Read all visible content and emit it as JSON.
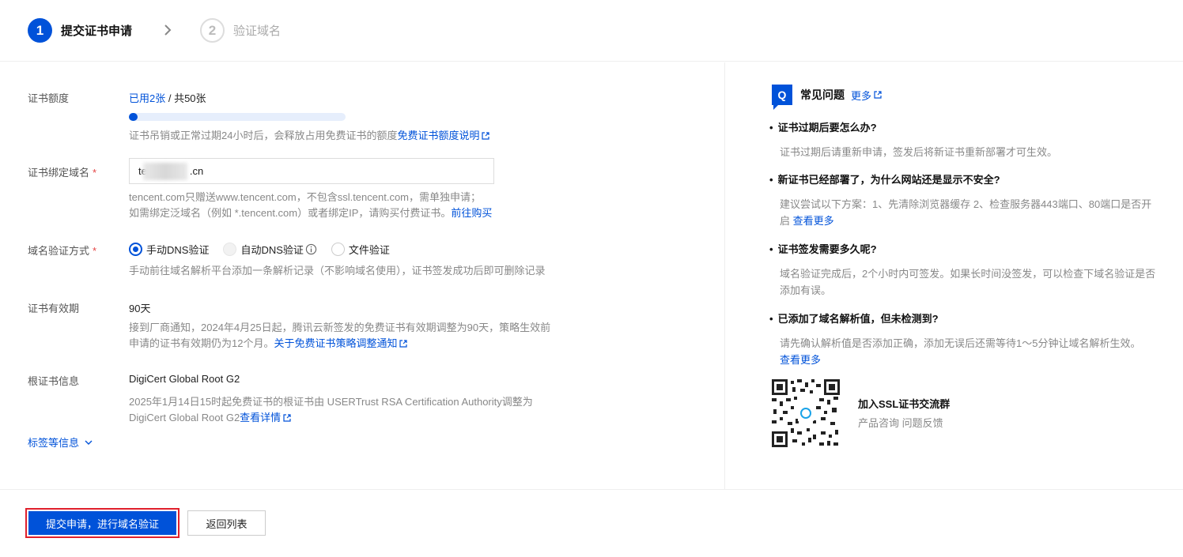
{
  "steps": [
    {
      "num": "1",
      "label": "提交证书申请"
    },
    {
      "num": "2",
      "label": "验证域名"
    }
  ],
  "quota": {
    "label": "证书额度",
    "used": "已用2张",
    "sep": " / ",
    "total": "共50张",
    "progress_fraction": 0.04,
    "help": "证书吊销或正常过期24小时后，会释放占用免费证书的额度",
    "help_link": "免费证书额度说明"
  },
  "domain": {
    "label": "证书绑定域名",
    "required_mark": "*",
    "value_prefix": "te",
    "value_suffix": ".cn",
    "help1": "tencent.com只赠送www.tencent.com，不包含ssl.tencent.com，需单独申请；",
    "help2": "如需绑定泛域名（例如 *.tencent.com）或者绑定IP，请购买付费证书。",
    "help2_link": "前往购买"
  },
  "verify": {
    "label": "域名验证方式",
    "required_mark": "*",
    "options": [
      "手动DNS验证",
      "自动DNS验证",
      "文件验证"
    ],
    "help": "手动前往域名解析平台添加一条解析记录（不影响域名使用），证书签发成功后即可删除记录"
  },
  "validity": {
    "label": "证书有效期",
    "value": "90天",
    "help1": "接到厂商通知，2024年4月25日起，腾讯云新签发的免费证书有效期调整为90天，策略生效前",
    "help2": "申请的证书有效期仍为12个月。",
    "help2_link": "关于免费证书策略调整通知"
  },
  "root": {
    "label": "根证书信息",
    "value": "DigiCert Global Root G2",
    "help1": "2025年1月14日15时起免费证书的根证书由 USERTrust RSA Certification Authority调整为",
    "help2": "DigiCert Global Root G2",
    "help2_link": "查看详情"
  },
  "tags_label": "标签等信息",
  "faq": {
    "logo": "Q",
    "title": "常见问题",
    "more": "更多",
    "items": [
      {
        "q": "证书过期后要怎么办?",
        "a": "证书过期后请重新申请，签发后将新证书重新部署才可生效。",
        "a_link": ""
      },
      {
        "q": "新证书已经部署了，为什么网站还是显示不安全?",
        "a": "建议尝试以下方案：1、先清除浏览器缓存 2、检查服务器443端口、80端口是否开启 ",
        "a_link": "查看更多"
      },
      {
        "q": "证书签发需要多久呢?",
        "a": "域名验证完成后，2个小时内可签发。如果长时间没签发，可以检查下域名验证是否添加有误。",
        "a_link": ""
      },
      {
        "q": "已添加了域名解析值，但未检测到?",
        "a": "请先确认解析值是否添加正确，添加无误后还需等待1～5分钟让域名解析生效。",
        "a_link": "查看更多"
      }
    ],
    "join_title": "加入SSL证书交流群",
    "join_sub": "产品咨询 问题反馈"
  },
  "footer": {
    "submit": "提交申请，进行域名验证",
    "back": "返回列表"
  },
  "colors": {
    "accent": "#0052d9",
    "required": "#e54545",
    "highlight_border": "#e0202c"
  }
}
